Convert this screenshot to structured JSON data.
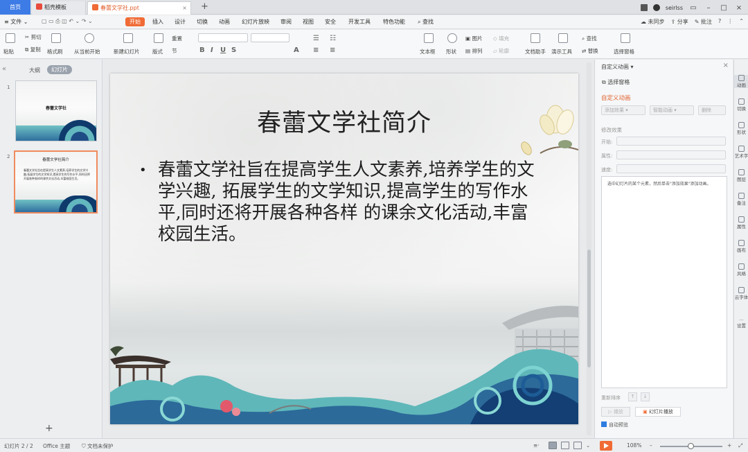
{
  "tabs": {
    "home": "首页",
    "template": "稻壳模板",
    "document": "春蕾文学社.ppt",
    "add": "+"
  },
  "titlebar": {
    "user": "seirlss"
  },
  "menu": {
    "file": "≡ 文件 ⌄",
    "items": [
      "开始",
      "插入",
      "设计",
      "切换",
      "动画",
      "幻灯片放映",
      "审阅",
      "视图",
      "安全",
      "开发工具",
      "特色功能"
    ],
    "search": "查找",
    "sync": "未同步",
    "share": "分享",
    "comment": "批注"
  },
  "ribbon": {
    "paste": "粘贴",
    "cut": "剪切",
    "copy": "复制",
    "format_painter": "格式刷",
    "from_current": "从当前开始",
    "new_slide": "新建幻灯片",
    "layout": "版式",
    "reset": "重置",
    "section": "节",
    "textbox": "文本框",
    "shape": "形状",
    "picture": "图片",
    "arrange": "排列",
    "outline": "轮廓",
    "fill": "填充",
    "doc_helper": "文档助手",
    "present_tools": "演示工具",
    "find": "查找",
    "replace": "替换",
    "select_pane": "选择窗格"
  },
  "left_panel": {
    "outline_tab": "大纲",
    "slides_tab": "幻灯片",
    "thumbs": [
      {
        "num": "1",
        "title": "春蕾文学社"
      },
      {
        "num": "2",
        "title": "春蕾文学社简介",
        "body": "春蕾文学社旨在提高学生人文素养,培养学生的文学兴趣,拓展学生的文学知识,提高学生的写作水平,同时还将开展各种各样的课余文化活动,丰富校园生活。"
      }
    ]
  },
  "slide": {
    "title": "春蕾文学社简介",
    "body": "春蕾文学社旨在提高学生人文素养,培养学生的文学兴趣, 拓展学生的文学知识,提高学生的写作水平,同时还将开展各种各样 的课余文化活动,丰富校园生活。"
  },
  "right_panel": {
    "title": "自定义动画 ▾",
    "select_pane": "选择窗格",
    "custom_anim": "自定义动画",
    "add_effect": "添加效果 ▾",
    "smart_anim": "智能动画 ▾",
    "delete": "删除",
    "modify": "修改效果",
    "start_label": "开始:",
    "property_label": "属性:",
    "speed_label": "速度:",
    "hint": "选中幻灯片的某个元素，然后单击\"添加效果\"添加动画。",
    "reorder": "重新排序",
    "play": "播放",
    "slideshow": "幻灯片播放",
    "autopreview": "自动预览"
  },
  "right_strip": [
    "动画",
    "切换",
    "形状",
    "艺术字",
    "图层",
    "备注",
    "属性",
    "画布",
    "风格",
    "云字体",
    "设置"
  ],
  "status": {
    "slide_count": "幻灯片 2 / 2",
    "theme": "Office 主题",
    "protect": "文档未保护",
    "zoom": "108%"
  }
}
